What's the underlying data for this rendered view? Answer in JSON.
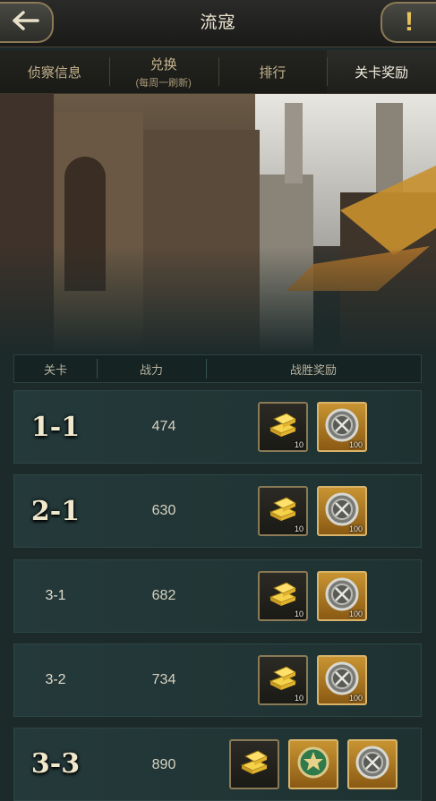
{
  "header": {
    "title": "流寇"
  },
  "tabs": [
    {
      "label": "侦察信息",
      "sub": "",
      "active": false
    },
    {
      "label": "兑换",
      "sub": "(每周一刷新)",
      "active": false
    },
    {
      "label": "排行",
      "sub": "",
      "active": false
    },
    {
      "label": "关卡奖励",
      "sub": "",
      "active": true
    }
  ],
  "table": {
    "headers": [
      "关卡",
      "战力",
      "战胜奖励"
    ],
    "rows": [
      {
        "stage": "1-1",
        "power": "474",
        "rewards": [
          {
            "icon": "gold-bars-icon",
            "qty": "10"
          },
          {
            "icon": "silver-coin-icon",
            "qty": "100"
          }
        ]
      },
      {
        "stage": "2-1",
        "power": "630",
        "rewards": [
          {
            "icon": "gold-bars-icon",
            "qty": "10"
          },
          {
            "icon": "silver-coin-icon",
            "qty": "100"
          }
        ]
      },
      {
        "stage": "3-1",
        "power": "682",
        "rewards": [
          {
            "icon": "gold-bars-icon",
            "qty": "10"
          },
          {
            "icon": "silver-coin-icon",
            "qty": "100"
          }
        ]
      },
      {
        "stage": "3-2",
        "power": "734",
        "rewards": [
          {
            "icon": "gold-bars-icon",
            "qty": "10"
          },
          {
            "icon": "silver-coin-icon",
            "qty": "100"
          }
        ]
      },
      {
        "stage": "3-3",
        "power": "890",
        "rewards": [
          {
            "icon": "gold-bars-icon",
            "qty": ""
          },
          {
            "icon": "green-medal-icon",
            "qty": ""
          },
          {
            "icon": "silver-coin-icon",
            "qty": ""
          }
        ]
      }
    ]
  },
  "colors": {
    "accent_gold": "#8a7a56",
    "row_bg": "#24393a",
    "title_text": "#efe8d4"
  }
}
